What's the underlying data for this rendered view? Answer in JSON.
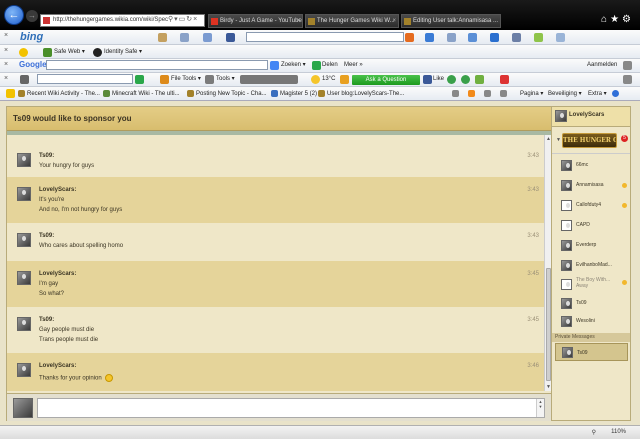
{
  "browser": {
    "url": "http://thehungergames.wikia.com/wiki/Spec",
    "tabs": [
      {
        "label": "thehungergames.wikia...",
        "active": true,
        "color": "#c33"
      },
      {
        "label": "Birdy - Just A Game - YouTube",
        "active": false,
        "color": "#d32"
      },
      {
        "label": "The Hunger Games Wiki W...",
        "active": false,
        "color": "#a3822b"
      },
      {
        "label": "Editing User talk:Annamisasa ...",
        "active": false,
        "color": "#a3822b"
      }
    ]
  },
  "toolbars": {
    "bing": {
      "logo": "bing"
    },
    "safeweb": {
      "label": "Safe Web ▾",
      "identity": "Identity Safe ▾"
    },
    "google": {
      "logo": "Google",
      "search": "Zoeken ▾",
      "share": "Delen",
      "more": "Meer »",
      "signin": "Aanmelden"
    },
    "ask": {
      "file_tools": "File Tools ▾",
      "tools": "Tools ▾",
      "weather": "13°C",
      "ask_button": "Ask a Question",
      "like": "Like"
    },
    "favorites": [
      "Recent Wiki Activity - The...",
      "Minecraft Wiki - The ulti...",
      "Posting New Topic - Cha...",
      "Magister 5 (2)",
      "User blog:LovelyScars-The..."
    ],
    "commands": {
      "page": "Pagina ▾",
      "security": "Beveiliging ▾",
      "extra": "Extra ▾"
    }
  },
  "chat": {
    "title": "Ts09 would like to sponsor you",
    "messages": [
      {
        "user": "Ts09:",
        "lines": [
          "Your hungry for guys"
        ],
        "time": "3:43"
      },
      {
        "user": "LovelyScars:",
        "lines": [
          "It's you're",
          "And no, I'm not hungry for guys"
        ],
        "time": "3:43"
      },
      {
        "user": "Ts09:",
        "lines": [
          "Who cares about spelling homo"
        ],
        "time": "3:43"
      },
      {
        "user": "LovelyScars:",
        "lines": [
          "I'm gay",
          "So what?"
        ],
        "time": "3:45"
      },
      {
        "user": "Ts09:",
        "lines": [
          "Gay people must die",
          "Trans people must die"
        ],
        "time": "3:45"
      },
      {
        "user": "LovelyScars:",
        "lines": [
          "Thanks for your opinion"
        ],
        "time": "3:46"
      }
    ],
    "input_placeholder": ""
  },
  "sidebar": {
    "me": "LovelyScars",
    "logo": "THE HUNGER GAMES WIKI",
    "badge": "5",
    "users": [
      {
        "name": "66mc",
        "away": false,
        "dot": false
      },
      {
        "name": "Annamisasa",
        "away": false,
        "dot": true
      },
      {
        "name": "Callofduty4",
        "away": false,
        "dot": true
      },
      {
        "name": "CAPD",
        "away": false,
        "dot": false
      },
      {
        "name": "Everderp",
        "away": false,
        "dot": false
      },
      {
        "name": "EvilhanboMad...",
        "away": false,
        "dot": false
      },
      {
        "name": "The Boy With... Away",
        "away": true,
        "dot": true
      },
      {
        "name": "Ts09",
        "away": false,
        "dot": false
      },
      {
        "name": "Wesolini",
        "away": false,
        "dot": false
      }
    ],
    "pm_header": "Private Messages",
    "pm_user": "Ts09"
  },
  "statusbar": {
    "zoom": "110%"
  }
}
